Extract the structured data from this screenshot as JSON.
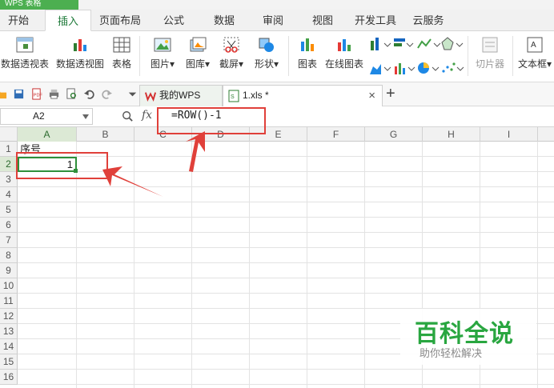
{
  "app": {
    "badge": "WPS 表格"
  },
  "tabs": [
    "开始",
    "插入",
    "页面布局",
    "公式",
    "数据",
    "审阅",
    "视图",
    "开发工具",
    "云服务"
  ],
  "active_tab": "插入",
  "ribbon": {
    "pivot_table": "数据透视表",
    "pivot_chart": "数据透视图",
    "table": "表格",
    "picture": "图片",
    "gallery": "图库",
    "screenshot": "截屏",
    "shapes": "形状",
    "chart": "图表",
    "online_chart": "在线图表",
    "slicer": "切片器",
    "textbox": "文本框",
    "dropdown_marker": "▾"
  },
  "doc_tabs": {
    "home": "我的WPS",
    "file": "1.xls *",
    "close": "×",
    "add": "+"
  },
  "formula_bar": {
    "name_box": "A2",
    "fx": "fx",
    "formula": "=ROW()-1"
  },
  "columns": [
    "A",
    "B",
    "C",
    "D",
    "E",
    "F",
    "G",
    "H",
    "I"
  ],
  "rows": [
    "1",
    "2",
    "3",
    "4",
    "5",
    "6",
    "7",
    "8",
    "9",
    "10",
    "11",
    "12",
    "13",
    "14",
    "15",
    "16"
  ],
  "cells": {
    "A1": "序号",
    "A2": "1"
  },
  "watermark": {
    "title": "百科全说",
    "subtitle": "助你轻松解决"
  },
  "colors": {
    "accent_green": "#29a640",
    "annotation_red": "#e0403a",
    "header_gray": "#f1f1f1"
  }
}
